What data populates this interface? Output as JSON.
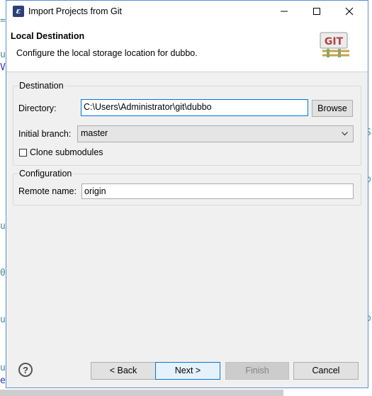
{
  "window": {
    "title": "Import Projects from Git",
    "minimize_glyph": "—",
    "maximize_glyph": "☐",
    "close_glyph": "✕"
  },
  "header": {
    "title": "Local Destination",
    "description": "Configure the local storage location for dubbo.",
    "logo_text": "GIT"
  },
  "destination": {
    "group_label": "Destination",
    "directory_label": "Directory:",
    "directory_value": "C:\\Users\\Administrator\\git\\dubbo",
    "browse_label": "Browse",
    "branch_label": "Initial branch:",
    "branch_value": "master",
    "clone_submodules_label": "Clone submodules",
    "clone_submodules_checked": false
  },
  "configuration": {
    "group_label": "Configuration",
    "remote_name_label": "Remote name:",
    "remote_name_value": "origin"
  },
  "footer": {
    "help_glyph": "?",
    "back_label": "< Back",
    "next_label": "Next >",
    "finish_label": "Finish",
    "cancel_label": "Cancel"
  },
  "colors": {
    "window_border": "#5c8ed6",
    "focus_border": "#0078d7",
    "dialog_bg": "#f0f0f0"
  }
}
